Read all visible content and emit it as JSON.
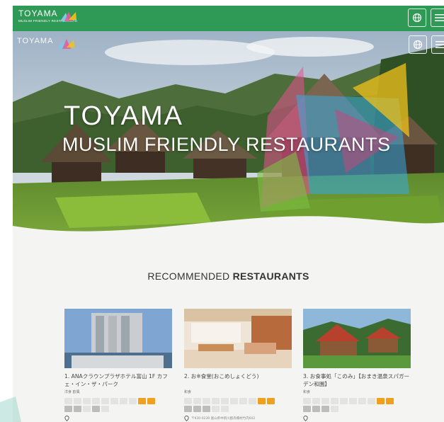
{
  "header": {
    "logo_title": "TOYAMA",
    "logo_subtitle": "MUSLIM FRIENDLY RESTAURANTS",
    "language_icon": "globe-icon",
    "menu_icon": "hamburger-menu-icon",
    "bar_color": "#2f9a56"
  },
  "hero": {
    "title": "TOYAMA",
    "subtitle": "MUSLIM FRIENDLY RESTAURANTS",
    "logo_title": "TOYAMA"
  },
  "section": {
    "heading_light": "RECOMMENDED ",
    "heading_bold": "RESTAURANTS"
  },
  "restaurants": [
    {
      "name": "1. ANAクラウンプラザホテル富山 1F カフェ・イン・ザ・パーク",
      "category": "洋食 欧風"
    },
    {
      "name": "2. お※食堂(おこめしょくどう)",
      "category": "和食",
      "address": "〒930-0239 富山県中新川郡舟橋村竹内602"
    },
    {
      "name": "3. お食事処「このみ」【おまき温泉スパガーデン和園】",
      "category": "和食"
    }
  ],
  "colors": {
    "accent_orange": "#f1a01e",
    "accent_green": "#2f9a56"
  }
}
